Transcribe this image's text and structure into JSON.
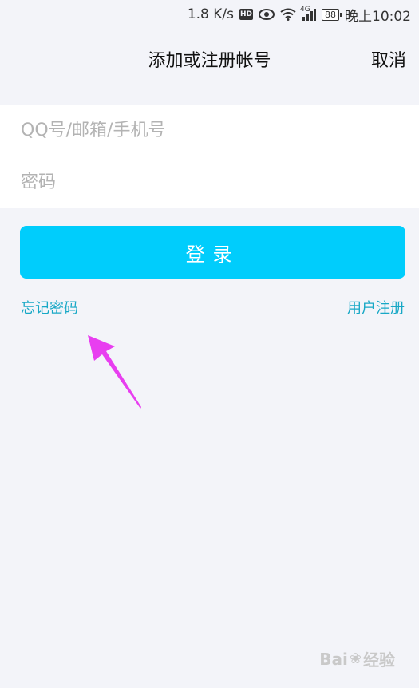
{
  "status_bar": {
    "speed": "1.8 K/s",
    "hd_label": "HD",
    "network_label": "4G",
    "battery": "88",
    "time": "晚上10:02"
  },
  "nav": {
    "title": "添加或注册帐号",
    "cancel": "取消"
  },
  "form": {
    "account_placeholder": "QQ号/邮箱/手机号",
    "password_placeholder": "密码"
  },
  "actions": {
    "login": "登录",
    "forgot_password": "忘记密码",
    "register": "用户注册"
  },
  "watermark": {
    "left": "Bai",
    "right": "经验"
  },
  "colors": {
    "accent": "#00cdfc",
    "link": "#18a8c6",
    "arrow": "#e83ef0"
  }
}
